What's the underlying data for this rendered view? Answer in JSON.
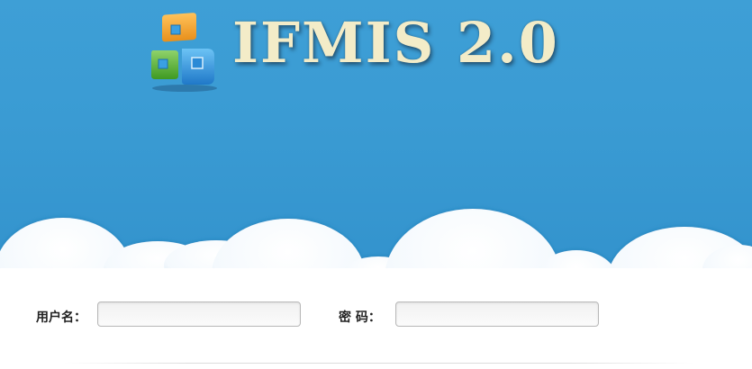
{
  "header": {
    "title": "IFMIS 2.0",
    "logo_icon": "windows-tiles-logo-icon"
  },
  "colors": {
    "sky": "#3a9bd3",
    "title": "#f3ecc8",
    "tile_orange": "#f2a530",
    "tile_green": "#5cb83c",
    "tile_blue": "#2e8fd8"
  },
  "login": {
    "username_label": "用户名：",
    "username_value": "",
    "password_label": "密  码：",
    "password_value": ""
  }
}
